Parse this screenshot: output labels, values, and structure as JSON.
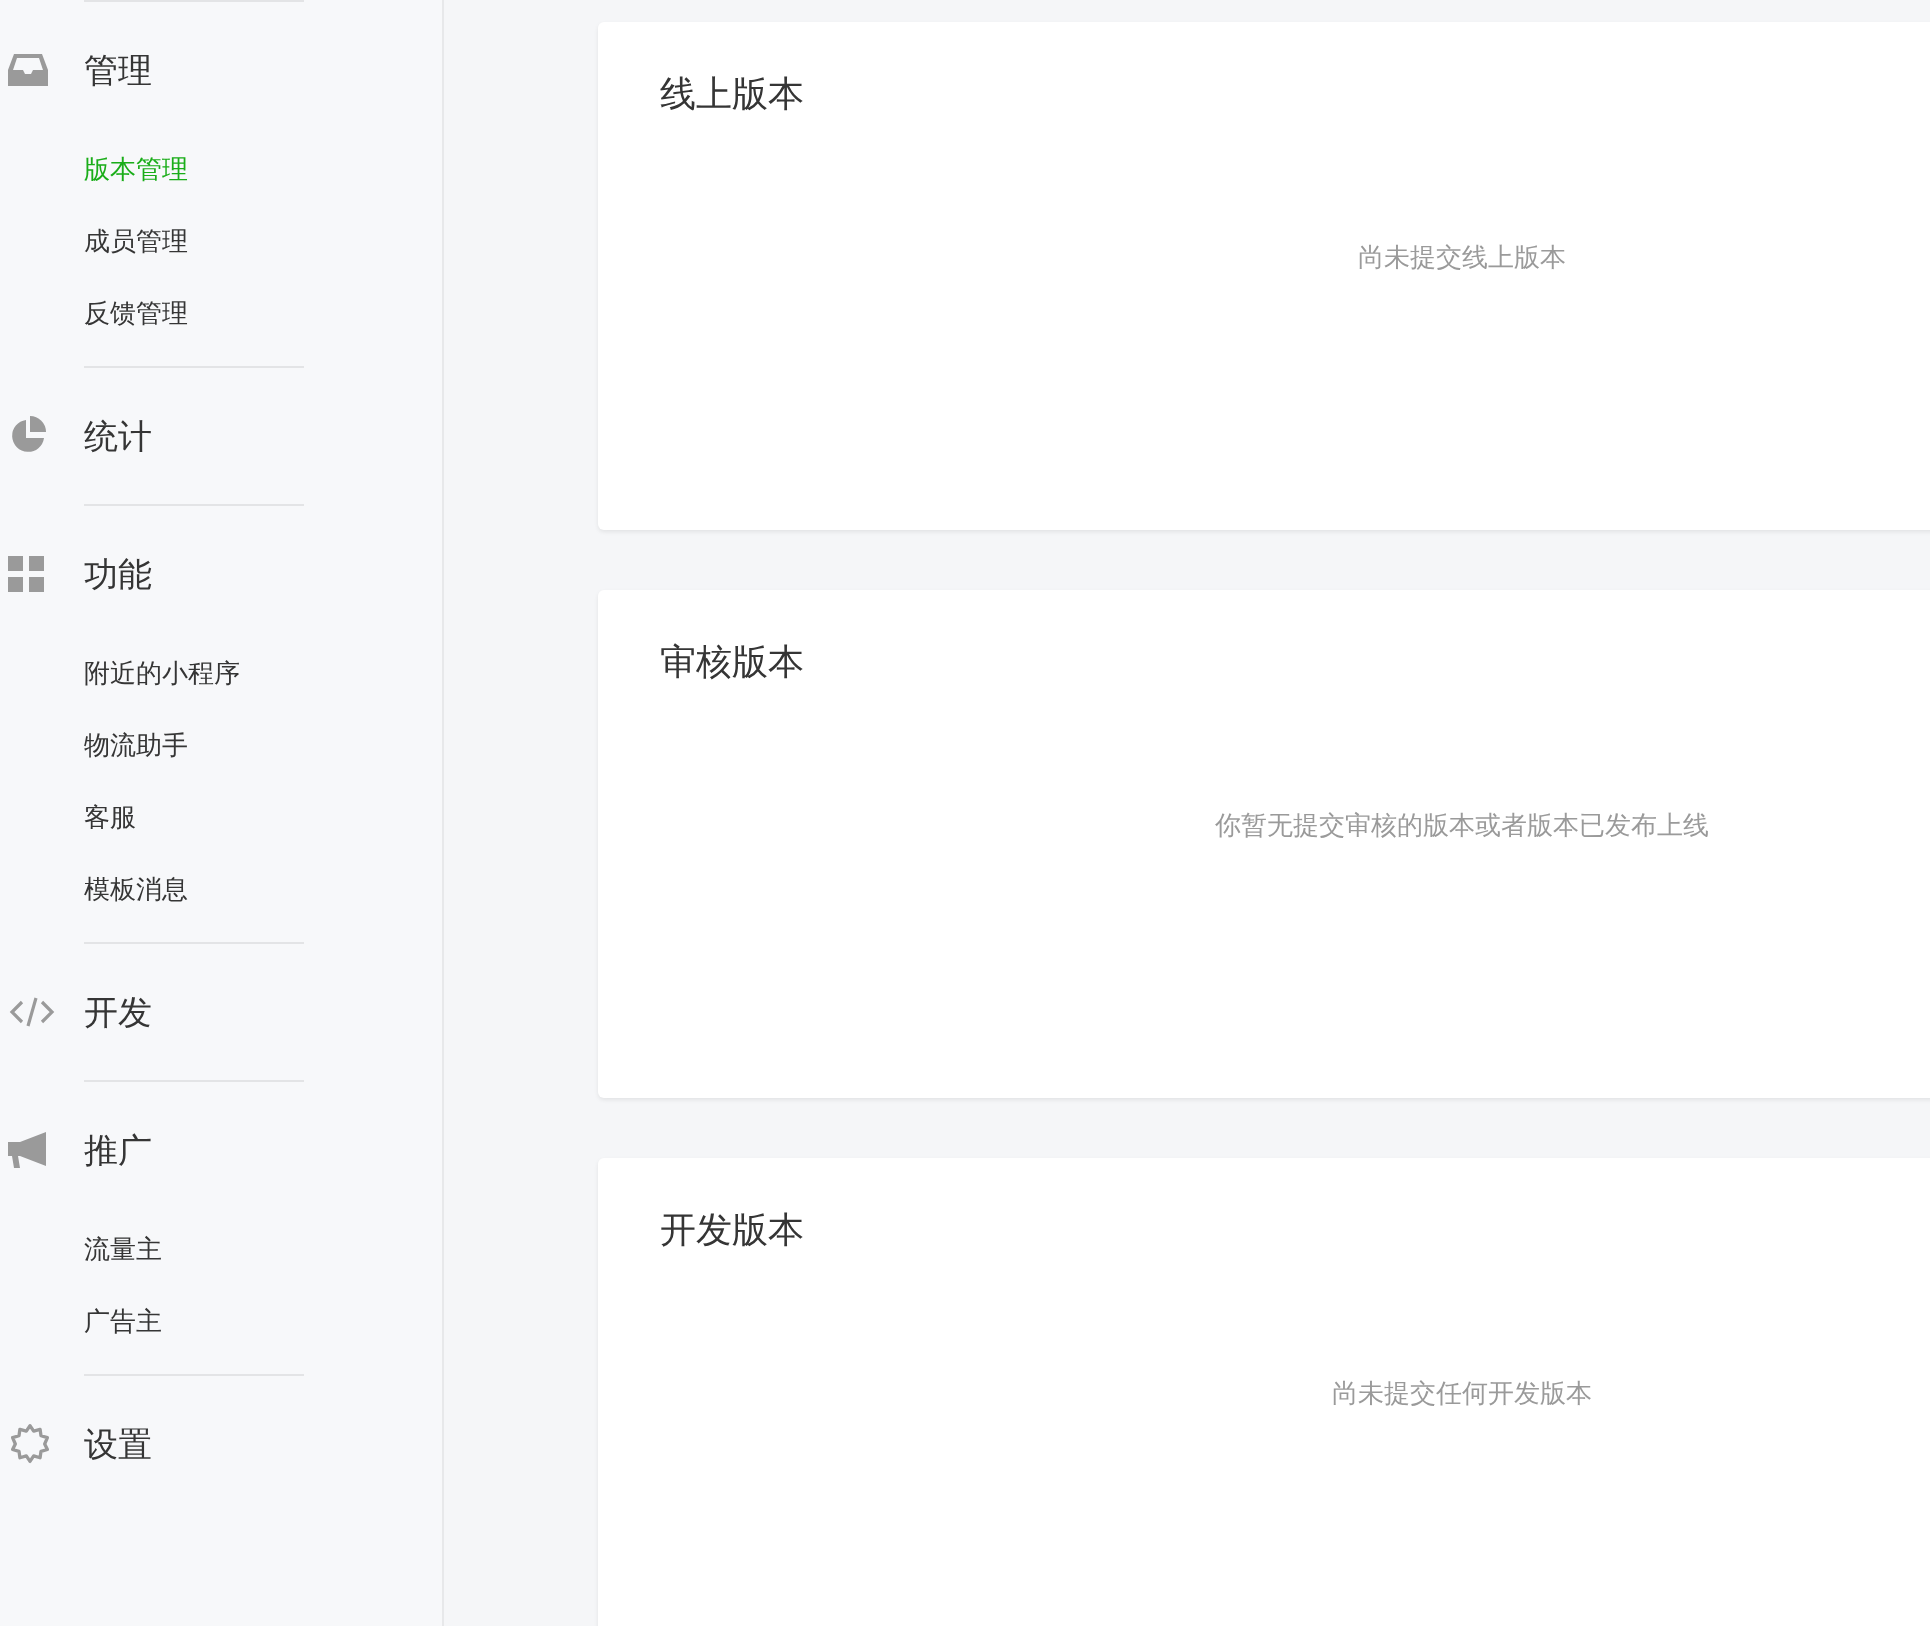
{
  "sidebar": {
    "sections": [
      {
        "label": "管理",
        "items": [
          {
            "label": "版本管理",
            "selected": true
          },
          {
            "label": "成员管理",
            "selected": false
          },
          {
            "label": "反馈管理",
            "selected": false
          }
        ]
      },
      {
        "label": "统计"
      },
      {
        "label": "功能",
        "items": [
          {
            "label": "附近的小程序",
            "selected": false
          },
          {
            "label": "物流助手",
            "selected": false
          },
          {
            "label": "客服",
            "selected": false
          },
          {
            "label": "模板消息",
            "selected": false
          }
        ]
      },
      {
        "label": "开发"
      },
      {
        "label": "推广",
        "items": [
          {
            "label": "流量主",
            "selected": false
          },
          {
            "label": "广告主",
            "selected": false
          }
        ]
      },
      {
        "label": "设置"
      }
    ]
  },
  "cards": [
    {
      "title": "线上版本",
      "empty_text": "尚未提交线上版本"
    },
    {
      "title": "审核版本",
      "empty_text": "你暂无提交审核的版本或者版本已发布上线"
    },
    {
      "title": "开发版本",
      "empty_text": "尚未提交任何开发版本"
    }
  ]
}
